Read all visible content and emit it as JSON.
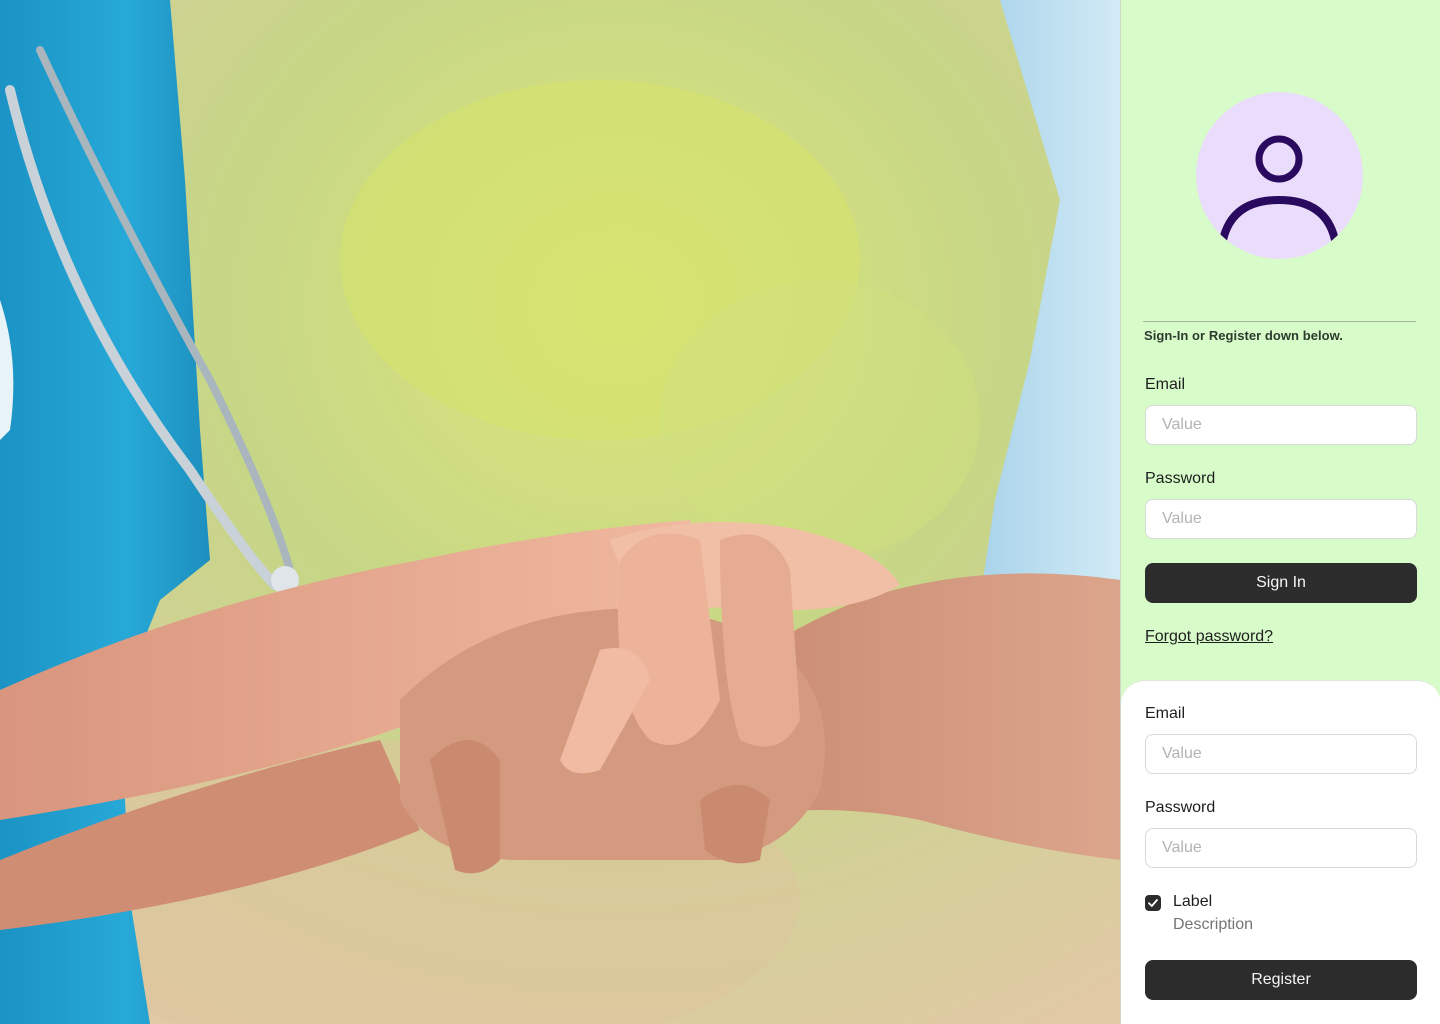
{
  "hero": {
    "alt": "Nurse holding an elderly patient's hands"
  },
  "panel": {
    "intro_text": "Sign-In or Register down below."
  },
  "sign_in": {
    "email_label": "Email",
    "email_placeholder": "Value",
    "password_label": "Password",
    "password_placeholder": "Value",
    "submit_label": "Sign In",
    "forgot_link": "Forgot password?"
  },
  "register": {
    "email_label": "Email",
    "email_placeholder": "Value",
    "password_label": "Password",
    "password_placeholder": "Value",
    "checkbox_label": "Label",
    "checkbox_description": "Description",
    "checkbox_checked": true,
    "submit_label": "Register"
  },
  "colors": {
    "panel_bg": "#d7fcc9",
    "avatar_bg": "#eadcfb",
    "avatar_icon": "#2a0a5e",
    "button_bg": "#2c2c2c"
  },
  "icons": {
    "avatar": "user-icon",
    "checkbox": "check-icon"
  }
}
